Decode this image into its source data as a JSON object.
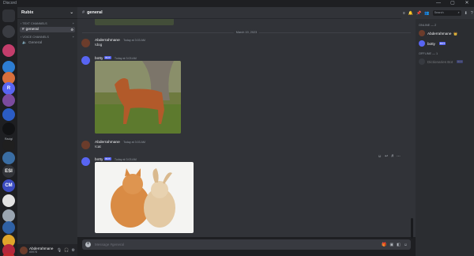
{
  "window": {
    "title": "Discord",
    "controls": [
      "—",
      "▢",
      "✕"
    ]
  },
  "rail": {
    "servers": [
      {
        "name": "Direct Messages",
        "abbr": "",
        "color": "#313338"
      },
      {
        "name": "server-2",
        "abbr": "",
        "color": "#3a3c42"
      },
      {
        "name": "server-3",
        "abbr": "",
        "color": "#c33d6b"
      },
      {
        "name": "server-4",
        "abbr": "",
        "color": "#2d7dd2"
      },
      {
        "name": "server-5",
        "abbr": "",
        "color": "#d86f3c"
      },
      {
        "name": "Rubix",
        "abbr": "R",
        "color": "#5865f2"
      },
      {
        "name": "server-7",
        "abbr": "",
        "color": "#7b4b9e"
      },
      {
        "name": "server-8",
        "abbr": "",
        "color": "#2b5cc5"
      },
      {
        "name": "server-9",
        "abbr": "",
        "color": "#111214"
      },
      {
        "name": "server-10",
        "abbr": "",
        "color": "#1f1f1f"
      },
      {
        "name": "server-11",
        "abbr": "",
        "color": "#3a6da3"
      },
      {
        "name": "server-12",
        "abbr": "ESI",
        "color": "#313338"
      },
      {
        "name": "server-13",
        "abbr": "CM",
        "color": "#3b4bbf"
      },
      {
        "name": "server-14",
        "abbr": "",
        "color": "#e2e2e2"
      },
      {
        "name": "server-15",
        "abbr": "",
        "color": "#9aa5b1"
      },
      {
        "name": "server-16",
        "abbr": "",
        "color": "#2f61a5"
      },
      {
        "name": "server-17",
        "abbr": "",
        "color": "#e0a62b"
      },
      {
        "name": "server-18",
        "abbr": "",
        "color": "#b5283c"
      },
      {
        "name": "server-19",
        "abbr": "",
        "color": "#c0282d"
      }
    ],
    "label": "Raoigi"
  },
  "sidebar": {
    "guild_name": "Rubix",
    "text_category": "Text Channels",
    "text_channels": [
      {
        "name": "general"
      }
    ],
    "voice_category": "Voice Channels",
    "voice_channels": [
      {
        "name": "General"
      }
    ]
  },
  "user": {
    "name": "Abderrahmane",
    "status": "#5978"
  },
  "header": {
    "channel": "general",
    "search_placeholder": "Search"
  },
  "chat": {
    "date_divider": "March 19, 2023",
    "messages": [
      {
        "author": "Abderrahmane",
        "timestamp": "Today at 3:03 AM",
        "text": "!dog"
      },
      {
        "author": "botty",
        "badge": "BOT",
        "timestamp": "Today at 3:03 AM",
        "image": "dog photo"
      },
      {
        "author": "Abderrahmane",
        "timestamp": "Today at 3:03 AM",
        "text": "!cat"
      },
      {
        "author": "botty",
        "badge": "BOT",
        "timestamp": "Today at 3:03 AM",
        "image": "cat and rabbit photo"
      }
    ],
    "composer_placeholder": "Message #general"
  },
  "members": {
    "online_label": "Online — 2",
    "online": [
      {
        "name": "Abderrahmane",
        "suffix": "👑",
        "color": "#6b3c2b"
      },
      {
        "name": "botty",
        "badge": "BOT",
        "color": "#5865f2"
      }
    ],
    "offline_label": "Offline — 1",
    "offline": [
      {
        "name": "Dictionaries Bot",
        "badge": "BOT",
        "color": "#4f545c"
      }
    ]
  },
  "colors": {
    "accent": "#5865f2",
    "online": "#23a55a"
  }
}
